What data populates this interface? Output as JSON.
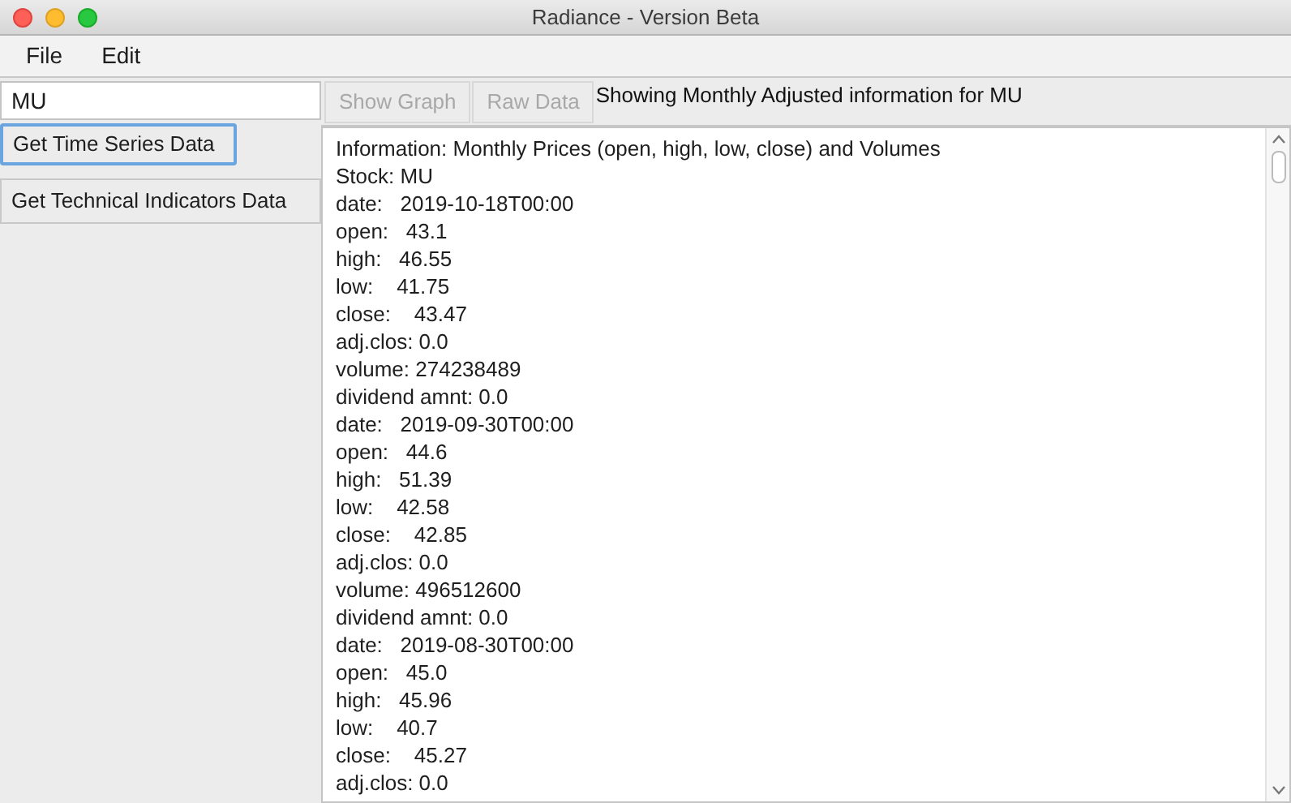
{
  "window": {
    "title": "Radiance - Version Beta"
  },
  "menu": [
    "File",
    "Edit"
  ],
  "symbol_field": {
    "value": "MU"
  },
  "side_buttons": [
    {
      "label": "Get Time Series Data",
      "focused": true
    },
    {
      "label": "Get Technical Indicators Data",
      "focused": false
    }
  ],
  "view_buttons": [
    {
      "label": "Show Graph",
      "disabled": true
    },
    {
      "label": "Raw Data",
      "disabled": true
    }
  ],
  "status_text": "Showing Monthly Adjusted information for MU",
  "output_lines": [
    "Information: Monthly Prices (open, high, low, close) and Volumes",
    "Stock: MU",
    "date:   2019-10-18T00:00",
    "open:   43.1",
    "high:   46.55",
    "low:    41.75",
    "close:    43.47",
    "adj.clos: 0.0",
    "volume: 274238489",
    "dividend amnt: 0.0",
    "date:   2019-09-30T00:00",
    "open:   44.6",
    "high:   51.39",
    "low:    42.58",
    "close:    42.85",
    "adj.clos: 0.0",
    "volume: 496512600",
    "dividend amnt: 0.0",
    "date:   2019-08-30T00:00",
    "open:   45.0",
    "high:   45.96",
    "low:    40.7",
    "close:    45.27",
    "adj.clos: 0.0"
  ]
}
